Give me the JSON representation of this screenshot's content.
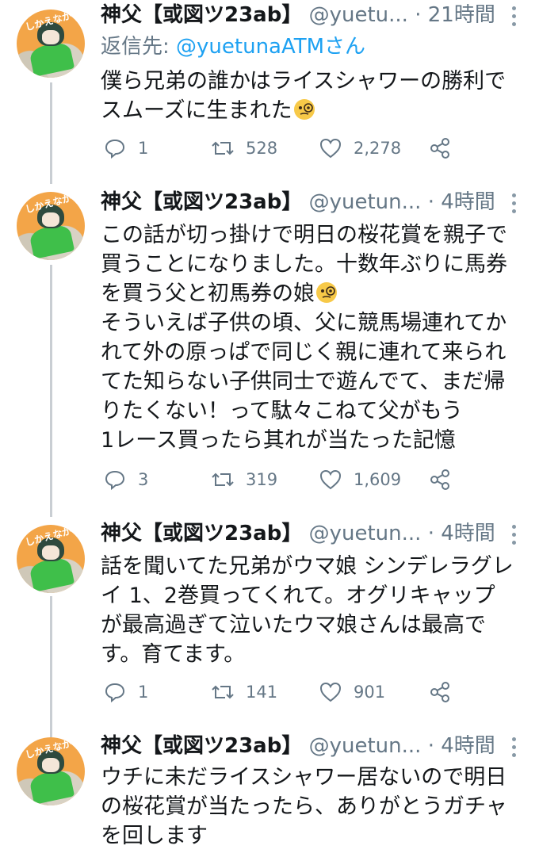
{
  "tweets": [
    {
      "name": "神父【或図ツ23ab】",
      "handle": "@yuetu...",
      "time": "21時間",
      "reply_prefix": "返信先: ",
      "reply_handle": "@yuetunaATMさん",
      "lines": [
        "僕ら兄弟の誰かはライスシャワーの勝利で",
        "スムーズに生まれた"
      ],
      "emoji_line": 1,
      "replies": "1",
      "retweets": "528",
      "likes": "2,278"
    },
    {
      "name": "神父【或図ツ23ab】",
      "handle": "@yuetun...",
      "time": "4時間",
      "lines": [
        "この話が切っ掛けで明日の桜花賞を親子で",
        "買うことになりました。十数年ぶりに馬券",
        "を買う父と初馬券の娘",
        "そういえば子供の頃、父に競馬場連れてか",
        "れて外の原っぱで同じく親に連れて来られ",
        "てた知らない子供同士で遊んでて、まだ帰",
        "りたくない！って駄々こねて父がもう",
        "1レース買ったら其れが当たった記憶"
      ],
      "emoji_line": 2,
      "replies": "3",
      "retweets": "319",
      "likes": "1,609"
    },
    {
      "name": "神父【或図ツ23ab】",
      "handle": "@yuetun...",
      "time": "4時間",
      "lines": [
        "話を聞いてた兄弟がウマ娘 シンデレラグレ",
        "イ 1、2巻買ってくれて。オグリキャップ",
        "が最高過ぎて泣いたウマ娘さんは最高で",
        "す。育てます。"
      ],
      "replies": "1",
      "retweets": "141",
      "likes": "901"
    },
    {
      "name": "神父【或図ツ23ab】",
      "handle": "@yuetun...",
      "time": "4時間",
      "lines": [
        "ウチに未だライスシャワー居ないので明日",
        "の桜花賞が当たったら、ありがとうガチャ",
        "を回します"
      ]
    }
  ],
  "avatar_text": "しかえなが",
  "icons": {
    "reply": "reply-bubble-icon",
    "retweet": "retweet-icon",
    "like": "heart-icon",
    "share": "share-icon",
    "more": "more-vertical-icon",
    "emoji": "face-with-monocle-emoji"
  },
  "colors": {
    "link": "#1da1f2",
    "muted": "#657786",
    "thread_line": "#c9ced3"
  }
}
